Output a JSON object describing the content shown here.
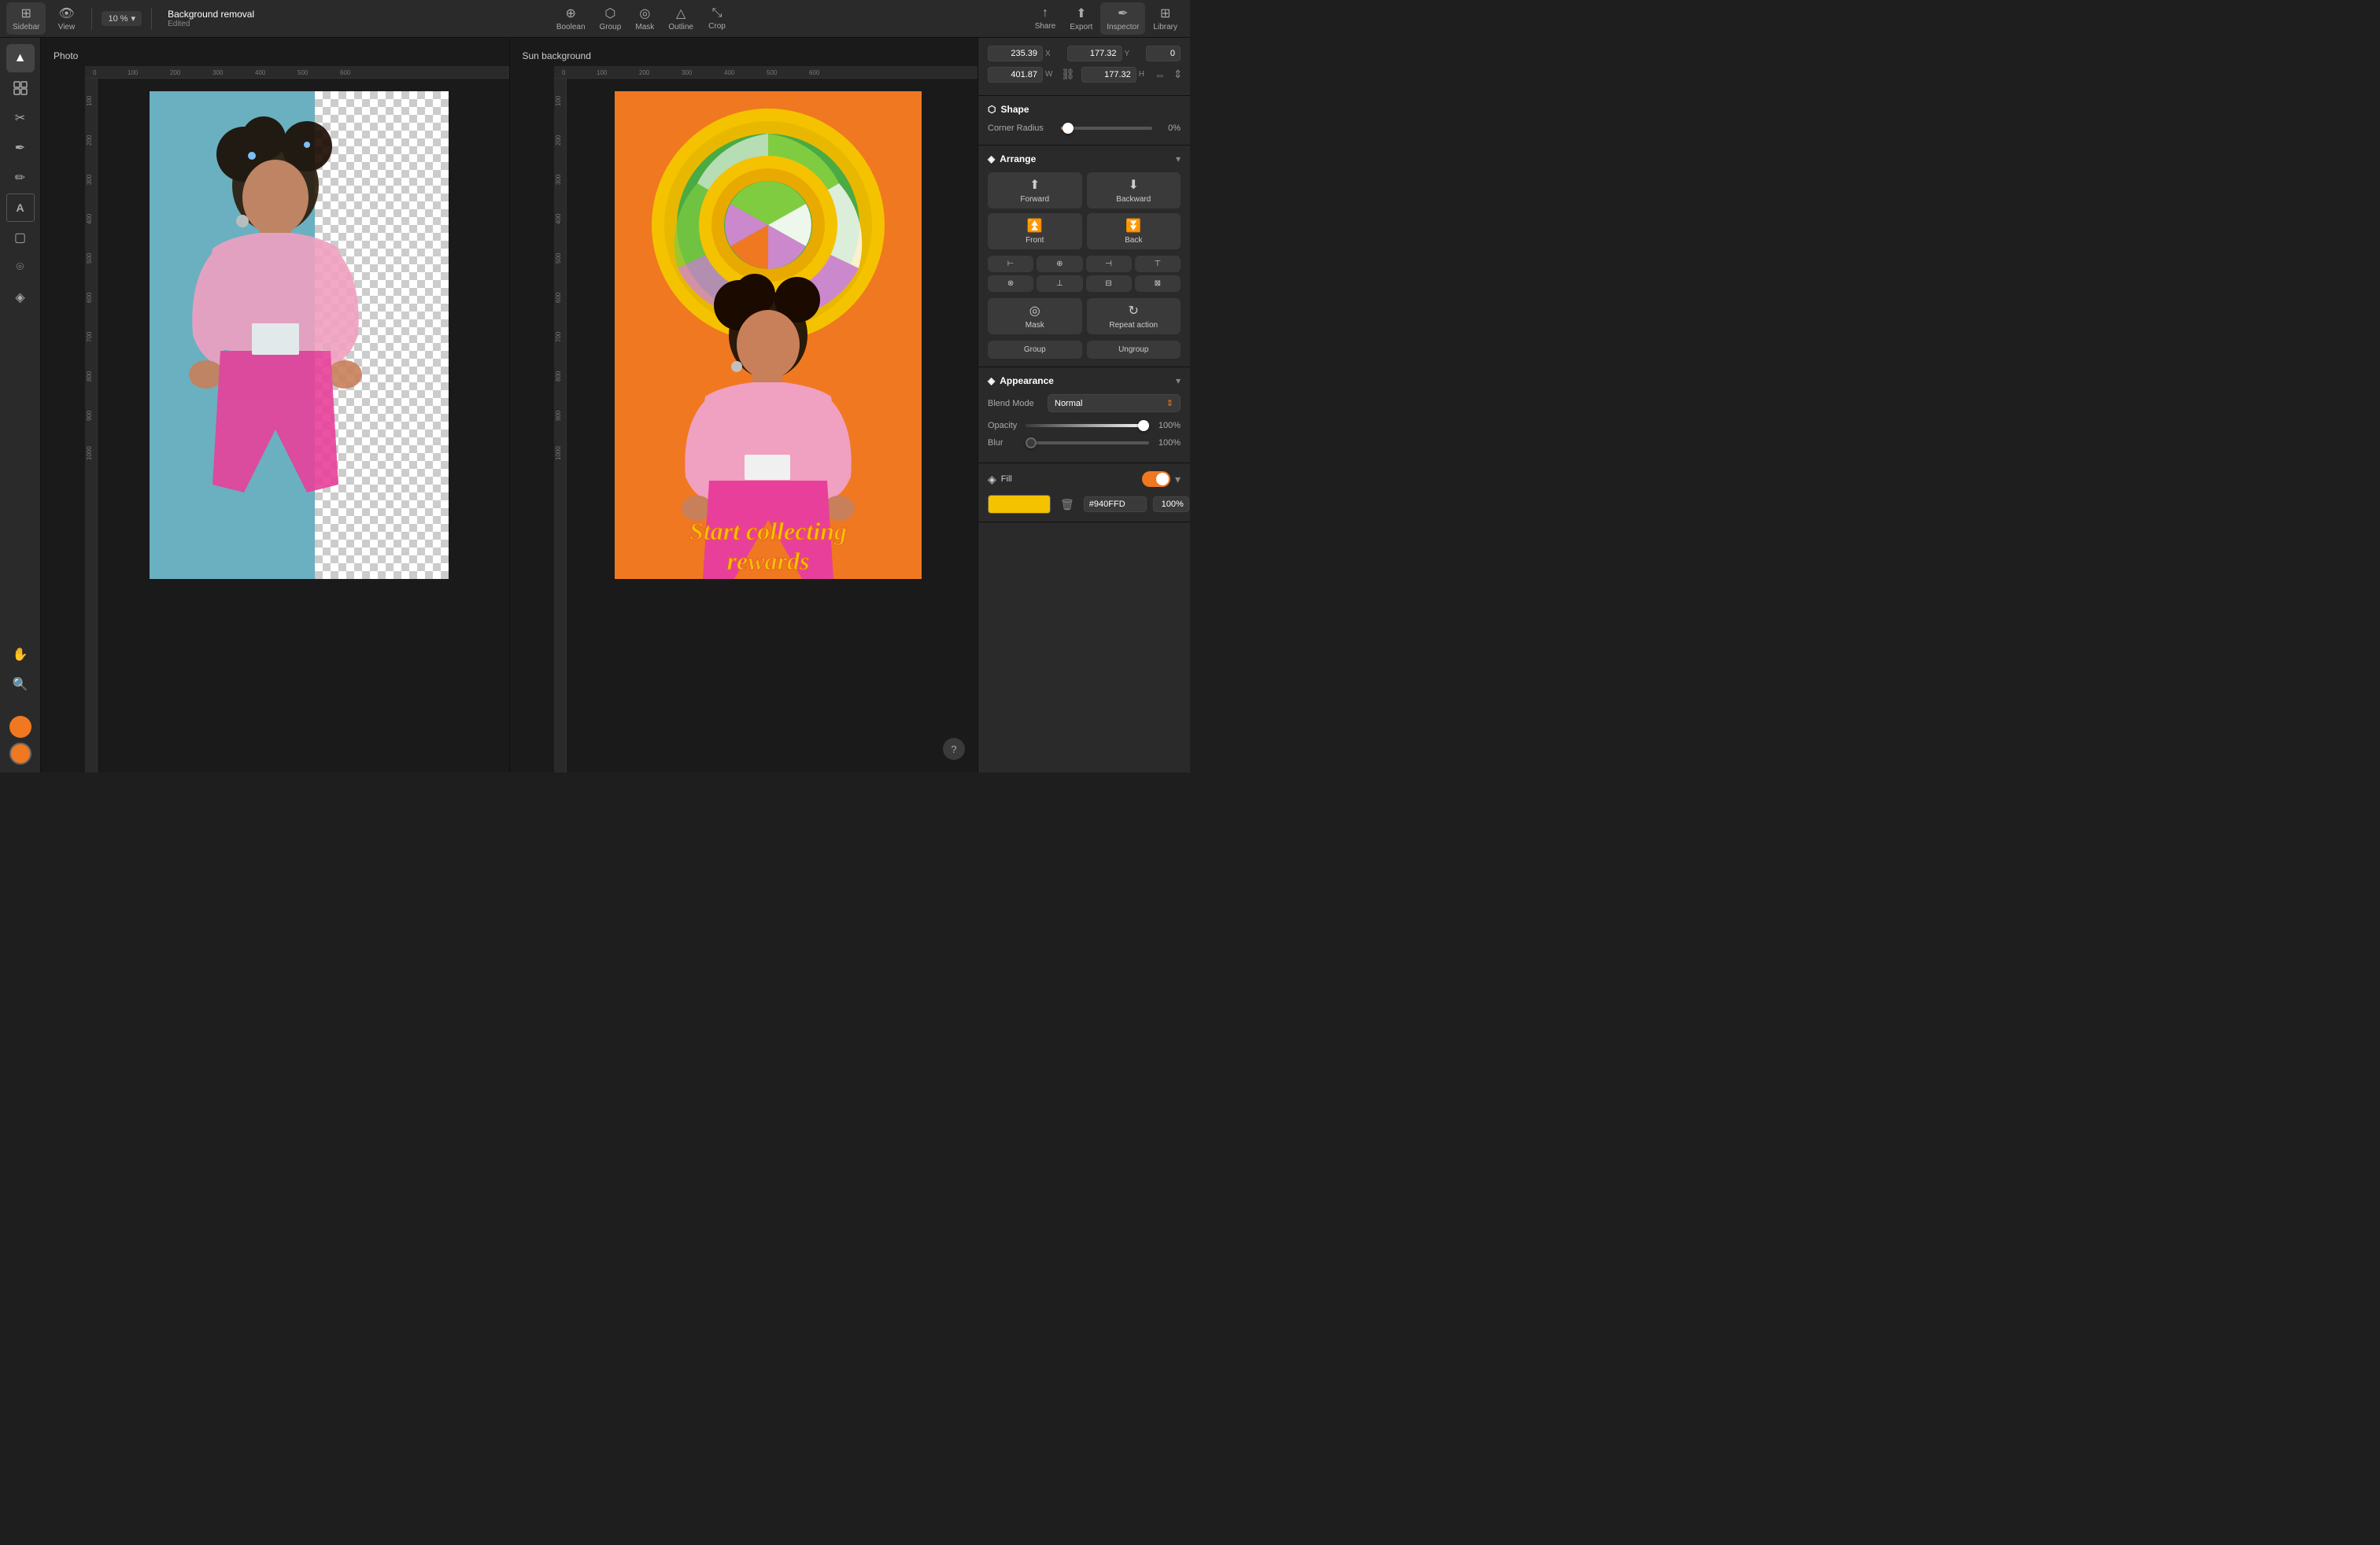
{
  "toolbar": {
    "sidebar_label": "Sidebar",
    "view_label": "View",
    "zoom_value": "10 %",
    "document_title": "Background removal",
    "document_status": "Edited",
    "boolean_label": "Boolean",
    "group_label": "Group",
    "mask_label": "Mask",
    "outline_label": "Outline",
    "crop_label": "Crop",
    "share_label": "Share",
    "export_label": "Export",
    "inspector_label": "Inspector",
    "library_label": "Library"
  },
  "canvas": {
    "panel1_label": "Photo",
    "panel2_label": "Sun background"
  },
  "inspector": {
    "x_value": "235.39",
    "x_label": "X",
    "y_value": "177.32",
    "y_label": "Y",
    "r_value": "0",
    "w_value": "401.87",
    "w_label": "W",
    "h_value": "177.32",
    "h_label": "H",
    "shape_title": "Shape",
    "corner_radius_label": "Corner Radius",
    "corner_radius_value": "0%",
    "arrange_title": "Arrange",
    "forward_label": "Forward",
    "backward_label": "Backward",
    "front_label": "Front",
    "back_label": "Back",
    "mask_label": "Mask",
    "repeat_action_label": "Repeat action",
    "group_label": "Group",
    "ungroup_label": "Ungroup",
    "appearance_title": "Appearance",
    "blend_mode_label": "Blend Mode",
    "blend_mode_value": "Normal",
    "opacity_label": "Opacity",
    "opacity_value": "100%",
    "blur_label": "Blur",
    "blur_value": "100%",
    "fill_title": "Fill",
    "fill_color": "#f5c800",
    "fill_hex": "#940FFD",
    "fill_opacity": "100%"
  },
  "tools": {
    "select": "▲",
    "multi_select": "⊡",
    "pen": "✒",
    "pencil": "✏",
    "text": "T",
    "rect": "▢",
    "lasso": "⌾",
    "eraser": "◈",
    "hand": "✋",
    "zoom": "🔍"
  },
  "colors": {
    "swatch1": "#f07820",
    "swatch2": "#f07820"
  }
}
